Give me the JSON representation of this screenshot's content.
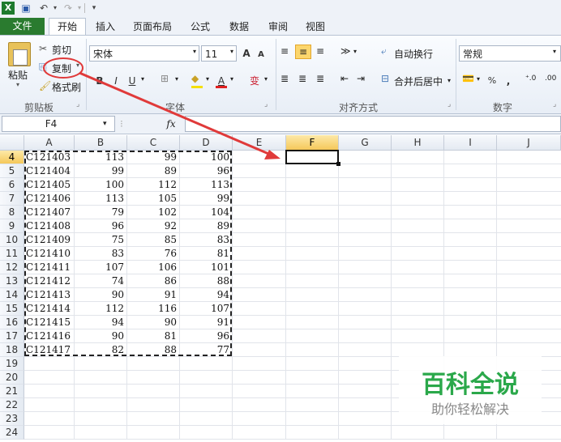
{
  "qat": {
    "save": "💾",
    "undo": "↶",
    "redo": "↷"
  },
  "tabs": [
    {
      "label": "文件"
    },
    {
      "label": "开始"
    },
    {
      "label": "插入"
    },
    {
      "label": "页面布局"
    },
    {
      "label": "公式"
    },
    {
      "label": "数据"
    },
    {
      "label": "审阅"
    },
    {
      "label": "视图"
    }
  ],
  "ribbon": {
    "clipboard": {
      "paste": "粘贴",
      "cut": "剪切",
      "copy": "复制",
      "painter": "格式刷",
      "group": "剪贴板"
    },
    "font": {
      "name": "宋体",
      "size": "11",
      "group": "字体",
      "bold": "B",
      "italic": "I",
      "underline": "U",
      "grow": "A",
      "shrink": "A",
      "fontcolor": "A",
      "phonetic": "变"
    },
    "align": {
      "wrap": "自动换行",
      "merge": "合并后居中",
      "group": "对齐方式"
    },
    "number": {
      "format": "常规",
      "percent": "%",
      "comma": ",",
      "inc": "←.0",
      ".dec": ".00",
      "group": "数字"
    }
  },
  "formula_bar": {
    "name": "F4",
    "fx": "fx",
    "value": ""
  },
  "columns": [
    "A",
    "B",
    "C",
    "D",
    "E",
    "F",
    "G",
    "H",
    "I",
    "J"
  ],
  "rows": [
    4,
    5,
    6,
    7,
    8,
    9,
    10,
    11,
    12,
    13,
    14,
    15,
    16,
    17,
    18,
    19,
    20,
    21,
    22,
    23,
    24
  ],
  "data": [
    [
      "C121403",
      "113",
      "99",
      "100"
    ],
    [
      "C121404",
      "99",
      "89",
      "96"
    ],
    [
      "C121405",
      "100",
      "112",
      "113"
    ],
    [
      "C121406",
      "113",
      "105",
      "99"
    ],
    [
      "C121407",
      "79",
      "102",
      "104"
    ],
    [
      "C121408",
      "96",
      "92",
      "89"
    ],
    [
      "C121409",
      "75",
      "85",
      "83"
    ],
    [
      "C121410",
      "83",
      "76",
      "81"
    ],
    [
      "C121411",
      "107",
      "106",
      "101"
    ],
    [
      "C121412",
      "74",
      "86",
      "88"
    ],
    [
      "C121413",
      "90",
      "91",
      "94"
    ],
    [
      "C121414",
      "112",
      "116",
      "107"
    ],
    [
      "C121415",
      "94",
      "90",
      "91"
    ],
    [
      "C121416",
      "90",
      "81",
      "96"
    ],
    [
      "C121417",
      "82",
      "88",
      "77"
    ]
  ],
  "watermark": {
    "title": "百科全说",
    "subtitle": "助你轻松解决"
  },
  "colors": {
    "file_tab": "#2a7b2f",
    "annotation": "#e03a3a",
    "watermark": "#2aa84a"
  }
}
